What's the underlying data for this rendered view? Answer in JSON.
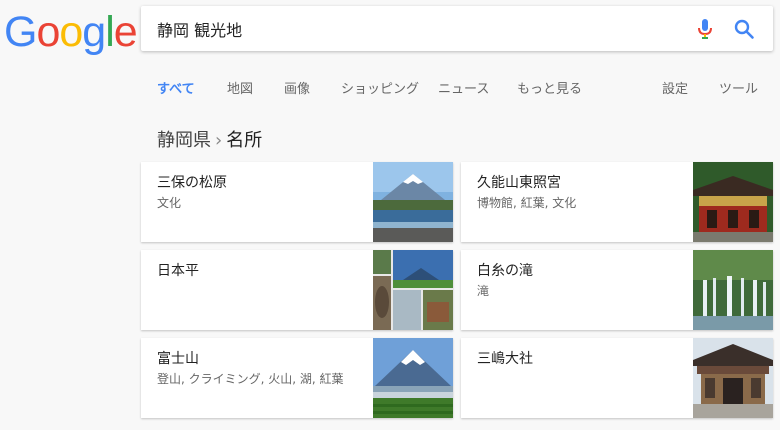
{
  "logo": {
    "letters": [
      "G",
      "o",
      "o",
      "g",
      "l",
      "e"
    ],
    "colors": [
      "#4285f4",
      "#ea4335",
      "#fbbc05",
      "#4285f4",
      "#34a853",
      "#ea4335"
    ]
  },
  "search": {
    "query": "静岡 観光地",
    "mic_icon": "microphone-icon",
    "search_icon": "magnifier-icon",
    "accent": "#4285f4"
  },
  "tabs": [
    {
      "label": "すべて",
      "active": true
    },
    {
      "label": "地図"
    },
    {
      "label": "画像"
    },
    {
      "label": "ショッピング"
    },
    {
      "label": "ニュース"
    },
    {
      "label": "もっと見る"
    },
    {
      "label": "設定"
    },
    {
      "label": "ツール"
    }
  ],
  "breadcrumb": {
    "parent": "静岡県",
    "separator": "›",
    "current": "名所"
  },
  "cards": [
    {
      "name": "三保の松原",
      "subtitle": "文化",
      "image": "mount-fuji-over-sea-thumbnail"
    },
    {
      "name": "久能山東照宮",
      "subtitle": "博物館, 紅葉, 文化",
      "image": "red-shrine-thumbnail"
    },
    {
      "name": "日本平",
      "subtitle": "",
      "image": "nihondaira-collage-thumbnail"
    },
    {
      "name": "白糸の滝",
      "subtitle": "滝",
      "image": "waterfall-thumbnail"
    },
    {
      "name": "富士山",
      "subtitle": "登山, クライミング, 火山, 湖, 紅葉",
      "image": "mount-fuji-fields-thumbnail"
    },
    {
      "name": "三嶋大社",
      "subtitle": "",
      "image": "shrine-gate-thumbnail"
    }
  ]
}
